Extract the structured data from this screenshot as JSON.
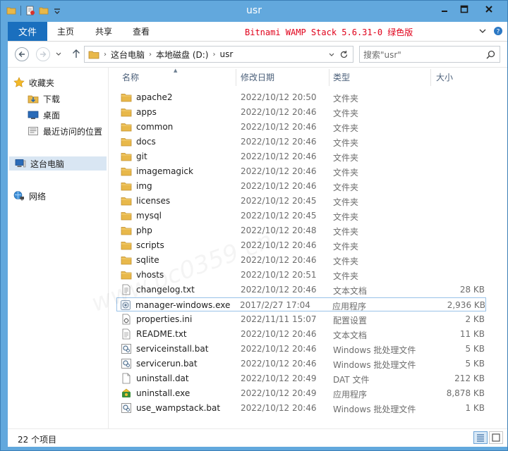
{
  "window": {
    "title": "usr"
  },
  "ribbon": {
    "tabs": [
      "文件",
      "主页",
      "共享",
      "查看"
    ],
    "note": "Bitnami WAMP Stack 5.6.31-0 绿色版"
  },
  "address": {
    "crumbs": [
      "这台电脑",
      "本地磁盘 (D:)",
      "usr"
    ]
  },
  "search": {
    "placeholder": "搜索\"usr\""
  },
  "nav": {
    "favorites": "收藏夹",
    "downloads": "下载",
    "desktop": "桌面",
    "recent": "最近访问的位置",
    "computer": "这台电脑",
    "network": "网络"
  },
  "columns": {
    "name": "名称",
    "date": "修改日期",
    "type": "类型",
    "size": "大小"
  },
  "files": [
    {
      "name": "apache2",
      "date": "2022/10/12 20:50",
      "type": "文件夹",
      "size": "",
      "icon": "folder-icon"
    },
    {
      "name": "apps",
      "date": "2022/10/12 20:46",
      "type": "文件夹",
      "size": "",
      "icon": "folder-icon"
    },
    {
      "name": "common",
      "date": "2022/10/12 20:46",
      "type": "文件夹",
      "size": "",
      "icon": "folder-icon"
    },
    {
      "name": "docs",
      "date": "2022/10/12 20:46",
      "type": "文件夹",
      "size": "",
      "icon": "folder-icon"
    },
    {
      "name": "git",
      "date": "2022/10/12 20:46",
      "type": "文件夹",
      "size": "",
      "icon": "folder-icon"
    },
    {
      "name": "imagemagick",
      "date": "2022/10/12 20:46",
      "type": "文件夹",
      "size": "",
      "icon": "folder-icon"
    },
    {
      "name": "img",
      "date": "2022/10/12 20:46",
      "type": "文件夹",
      "size": "",
      "icon": "folder-icon"
    },
    {
      "name": "licenses",
      "date": "2022/10/12 20:45",
      "type": "文件夹",
      "size": "",
      "icon": "folder-icon"
    },
    {
      "name": "mysql",
      "date": "2022/10/12 20:45",
      "type": "文件夹",
      "size": "",
      "icon": "folder-icon"
    },
    {
      "name": "php",
      "date": "2022/10/12 20:48",
      "type": "文件夹",
      "size": "",
      "icon": "folder-icon"
    },
    {
      "name": "scripts",
      "date": "2022/10/12 20:46",
      "type": "文件夹",
      "size": "",
      "icon": "folder-icon"
    },
    {
      "name": "sqlite",
      "date": "2022/10/12 20:46",
      "type": "文件夹",
      "size": "",
      "icon": "folder-icon"
    },
    {
      "name": "vhosts",
      "date": "2022/10/12 20:51",
      "type": "文件夹",
      "size": "",
      "icon": "folder-icon"
    },
    {
      "name": "changelog.txt",
      "date": "2022/10/12 20:46",
      "type": "文本文档",
      "size": "28 KB",
      "icon": "text-file-icon"
    },
    {
      "name": "manager-windows.exe",
      "date": "2017/2/27 17:04",
      "type": "应用程序",
      "size": "2,936 KB",
      "icon": "app-exe-icon",
      "selected": true
    },
    {
      "name": "properties.ini",
      "date": "2022/11/11 15:07",
      "type": "配置设置",
      "size": "2 KB",
      "icon": "ini-file-icon"
    },
    {
      "name": "README.txt",
      "date": "2022/10/12 20:46",
      "type": "文本文档",
      "size": "11 KB",
      "icon": "text-file-icon"
    },
    {
      "name": "serviceinstall.bat",
      "date": "2022/10/12 20:46",
      "type": "Windows 批处理文件",
      "size": "5 KB",
      "icon": "batch-file-icon"
    },
    {
      "name": "servicerun.bat",
      "date": "2022/10/12 20:46",
      "type": "Windows 批处理文件",
      "size": "5 KB",
      "icon": "batch-file-icon"
    },
    {
      "name": "uninstall.dat",
      "date": "2022/10/12 20:49",
      "type": "DAT 文件",
      "size": "212 KB",
      "icon": "blank-file-icon"
    },
    {
      "name": "uninstall.exe",
      "date": "2022/10/12 20:49",
      "type": "应用程序",
      "size": "8,878 KB",
      "icon": "uninstaller-icon"
    },
    {
      "name": "use_wampstack.bat",
      "date": "2022/10/12 20:46",
      "type": "Windows 批处理文件",
      "size": "1 KB",
      "icon": "batch-file-icon"
    }
  ],
  "status": {
    "count": "22 个项目"
  },
  "watermark": "www.pc0359.cn",
  "colors": {
    "titlebar": "#62a8dd",
    "file_tab": "#1a6fbe",
    "ribbon_note": "#e0001a",
    "selection_border": "#99c2e8",
    "folder": "#e8b84a"
  }
}
